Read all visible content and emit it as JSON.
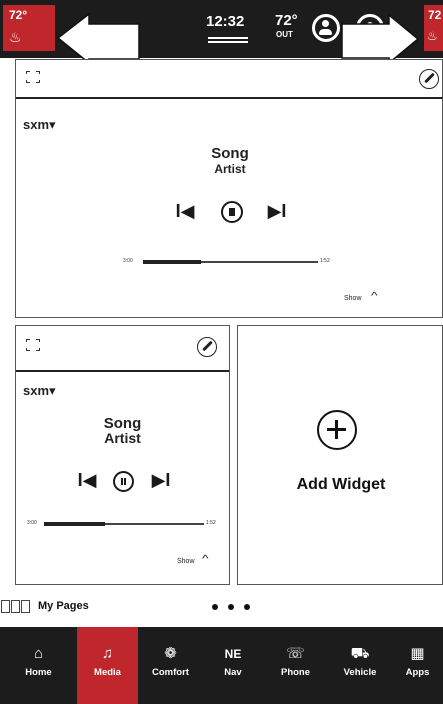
{
  "status_bar": {
    "left_climate": {
      "temp": "72°",
      "icon": "seat-heat-icon"
    },
    "right_climate": {
      "temp": "72",
      "icon": "seat-heat-icon"
    },
    "clock": "12:32",
    "outside_temp": "72°",
    "outside_label": "OUT",
    "icons": [
      "profile-icon",
      "notification-icon"
    ]
  },
  "widget_large": {
    "source": "sxm▾",
    "song": "Song",
    "artist": "Artist",
    "controls": {
      "prev": "I◀",
      "next": "▶I"
    },
    "elapsed": "3:00",
    "total": "1:52",
    "progress": 0.33,
    "show_label": "Show"
  },
  "widget_small": {
    "source": "sxm▾",
    "song": "Song",
    "artist": "Artist",
    "controls": {
      "prev": "I◀",
      "next": "▶I"
    },
    "elapsed": "3:00",
    "total": "1:52",
    "progress": 0.38,
    "show_label": "Show"
  },
  "add_widget": {
    "label": "Add Widget"
  },
  "pages": {
    "label": "My Pages",
    "dots": 3
  },
  "nav": {
    "active": "Media",
    "active_color": "#c0272d",
    "items": [
      {
        "label": "Home",
        "icon": "home-icon"
      },
      {
        "label": "Media",
        "icon": "music-note-icon"
      },
      {
        "label": "Comfort",
        "icon": "fan-icon"
      },
      {
        "label": "Nav",
        "icon": "compass-icon",
        "glyph": "NE"
      },
      {
        "label": "Phone",
        "icon": "phone-icon"
      },
      {
        "label": "Vehicle",
        "icon": "car-icon"
      },
      {
        "label": "Apps",
        "icon": "apps-grid-icon"
      }
    ]
  }
}
